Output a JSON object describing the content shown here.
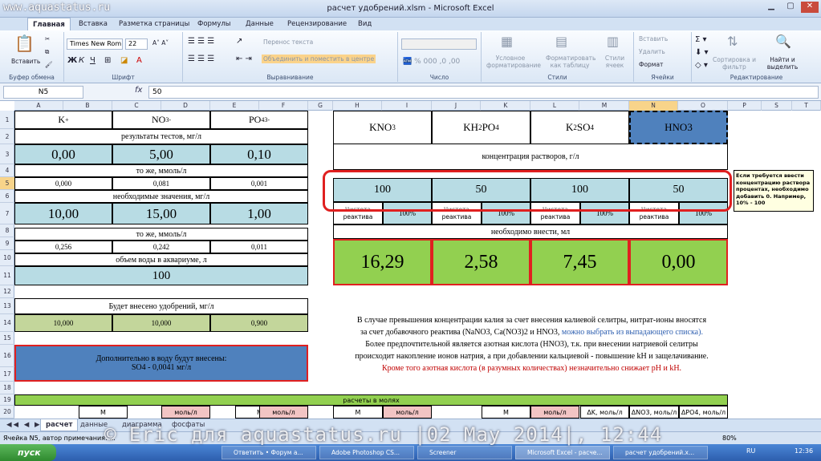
{
  "window": {
    "watermark_url": "www.aquastatus.ru",
    "title": "расчет удобрений.xlsm - Microsoft Excel"
  },
  "tabs": [
    "Главная",
    "Вставка",
    "Разметка страницы",
    "Формулы",
    "Данные",
    "Рецензирование",
    "Вид"
  ],
  "ribbon": {
    "paste": "Вставить",
    "clipboard": "Буфер обмена",
    "font_name": "Times New Rom",
    "font_size": "22",
    "font_group": "Шрифт",
    "wrap": "Перенос текста",
    "merge": "Объединить и поместить в центре",
    "align_group": "Выравнивание",
    "number_group": "Число",
    "cond": "Условное форматирование",
    "format_table": "Форматировать как таблицу",
    "cell_styles": "Стили ячеек",
    "styles_group": "Стили",
    "insert": "Вставить",
    "delete": "Удалить",
    "format": "Формат",
    "cells_group": "Ячейки",
    "sort": "Сортировка и фильтр",
    "find": "Найти и выделить",
    "edit_group": "Редактирование"
  },
  "formula_bar": {
    "name_box": "N5",
    "fx": "fx",
    "value": "50"
  },
  "columns": [
    "A",
    "B",
    "C",
    "D",
    "E",
    "F",
    "G",
    "H",
    "I",
    "J",
    "K",
    "L",
    "M",
    "N",
    "O",
    "P",
    "S",
    "T"
  ],
  "rows": [
    "1",
    "2",
    "3",
    "4",
    "5",
    "6",
    "7",
    "8",
    "9",
    "10",
    "11",
    "12",
    "13",
    "14",
    "15",
    "16",
    "17",
    "18",
    "19",
    "20"
  ],
  "left": {
    "k": "K",
    "k_sup": "+",
    "no3": "NO",
    "no3_sub": "3",
    "no3_sup": "-",
    "po4": "PO",
    "po4_sub": "4",
    "po4_sup": "3-",
    "tests_label": "результаты тестов, мг/л",
    "tests": [
      "0,00",
      "5,00",
      "0,10"
    ],
    "mmol_label": "то же, ммоль/л",
    "mmol": [
      "0,000",
      "0,081",
      "0,001"
    ],
    "need_label": "необходимые значения, мг/л",
    "need": [
      "10,00",
      "15,00",
      "1,00"
    ],
    "mmol2_label": "то же, ммоль/л",
    "mmol2": [
      "0,256",
      "0,242",
      "0,011"
    ],
    "volume_label": "объем воды в аквариуме, л",
    "volume": "100",
    "added_label": "Будет внесено удобрений, мг/л",
    "added": [
      "10,000",
      "10,000",
      "0,900"
    ],
    "extra_line1": "Дополнительно в воду будут внесены:",
    "extra_line2": "SO4 - 0,0041 мг/л"
  },
  "right": {
    "reagents": [
      [
        "KNO",
        "3",
        ""
      ],
      [
        "KH",
        "2",
        "PO",
        "4"
      ],
      [
        "K",
        "2",
        "SO",
        "4"
      ],
      [
        "HNO3"
      ]
    ],
    "conc_label": "концентрация растворов, г/л",
    "conc": [
      "100",
      "50",
      "100",
      "50"
    ],
    "pure_top": "Чистота",
    "pure_bottom": "реактива",
    "pure_pct": "100%",
    "need_label": "необходимо внести, мл",
    "need": [
      "16,29",
      "2,58",
      "7,45",
      "0,00"
    ]
  },
  "comment": "Если требуется ввести концентрацию раствора процентах, необходимо добавить 0. Например, 10% - 100",
  "note": {
    "line1": "В случае превышения концентрации калия за счет внесения калиевой селитры, нитрат-ионы вносятся",
    "line2a": "за счет добавочного реактива (NaNO3, Ca(NO3)2 и HNO3, ",
    "line2b": "можно выбрать из выпадающего списка).",
    "line3": "Более предпочтительной является азотная кислота (HNO3), т.к. при внесении натриевой селитры",
    "line4": "происходит накопление ионов натрия, а при добавлении кальциевой - повышение kH и защелачивание.",
    "line5": "Кроме того азотная кислота (в разумных количествах) незначительно снижает pH и kH."
  },
  "row19": "расчеты в молях",
  "row20": {
    "m": "М",
    "mol": "моль/л",
    "dk": "ΔK, моль/л",
    "dno3": "ΔNO3, моль/л",
    "dpo4": "ΔPO4, моль/л"
  },
  "sheets": [
    "расчет",
    "данные",
    "диаграмма",
    "фосфаты"
  ],
  "status": "Ячейка N5, автор примечания: ...",
  "zoom": "80%",
  "taskbar": {
    "start": "пуск",
    "items": [
      "Ответить • Форум а...",
      "Adobe Photoshop CS...",
      "Screener",
      "Microsoft Excel - расче...",
      "расчет удобрений.x..."
    ],
    "lang": "RU",
    "time": "12:36"
  },
  "watermark": "© Eric для aquastatus.ru |02 May 2014|, 12:44",
  "colors": {
    "blue_cell": "#b8dce4",
    "green_cell": "#c3d69b",
    "result_green": "#92d050",
    "extra_blue": "#4f81bd",
    "highlight_red": "#e02020"
  }
}
